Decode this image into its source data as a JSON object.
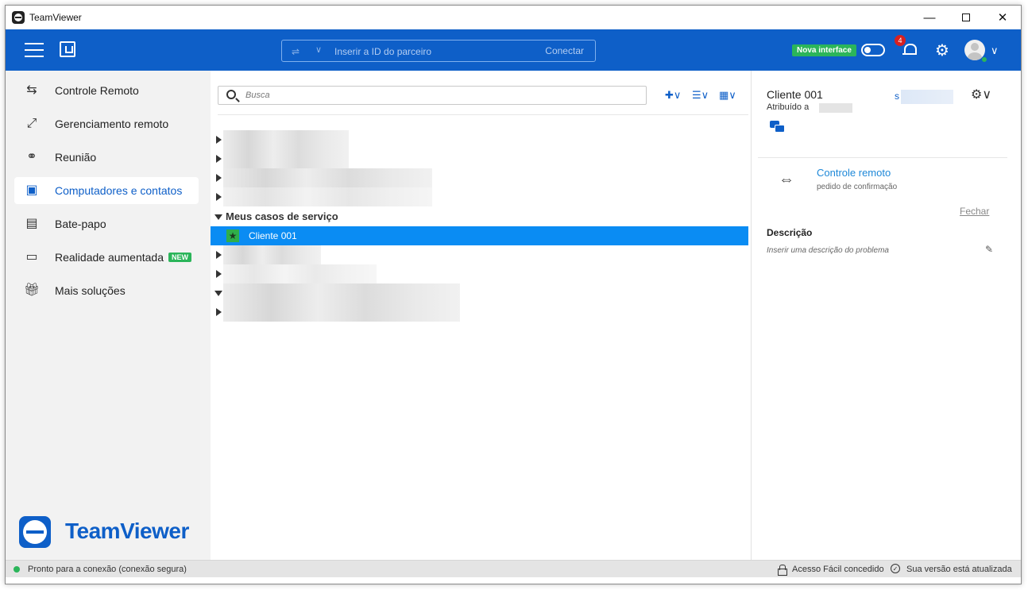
{
  "window": {
    "title": "TeamViewer"
  },
  "header": {
    "partner_placeholder": "Inserir a ID do parceiro",
    "connect_label": "Conectar",
    "new_ui_label": "Nova interface",
    "notification_count": "4"
  },
  "sidebar": {
    "items": [
      {
        "label": "Controle Remoto",
        "icon": "remote-control-icon"
      },
      {
        "label": "Gerenciamento remoto",
        "icon": "remote-management-icon"
      },
      {
        "label": "Reunião",
        "icon": "meeting-icon"
      },
      {
        "label": "Computadores e contatos",
        "icon": "contacts-icon",
        "active": true
      },
      {
        "label": "Bate-papo",
        "icon": "chat-icon"
      },
      {
        "label": "Realidade aumentada",
        "icon": "ar-icon",
        "badge": "NEW"
      },
      {
        "label": "Mais soluções",
        "icon": "gift-icon"
      }
    ],
    "brand": "TeamViewer"
  },
  "contacts": {
    "search_placeholder": "Busca",
    "group_label": "Meus casos de serviço",
    "selected_item": "Cliente 001"
  },
  "details": {
    "client_name": "Cliente 001",
    "assigned_label": "Atribuído a",
    "s_prefix": "s",
    "remote_control_title": "Controle remoto",
    "remote_control_sub": "pedido de confirmação",
    "close_label": "Fechar",
    "description_label": "Descrição",
    "description_placeholder": "Inserir uma descrição do problema"
  },
  "status": {
    "connection": "Pronto para a conexão (conexão segura)",
    "easy_access": "Acesso Fácil concedido",
    "version": "Sua versão está atualizada"
  },
  "colors": {
    "brand_blue": "#0e5fc8",
    "selection_blue": "#0a8cf3",
    "online_green": "#2bb55a"
  }
}
